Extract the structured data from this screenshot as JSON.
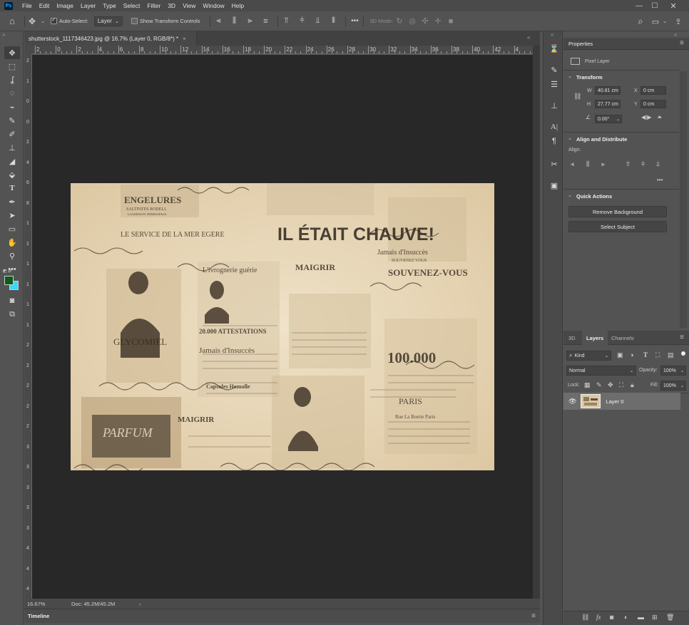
{
  "menubar": {
    "logo": "Ps",
    "items": [
      "File",
      "Edit",
      "Image",
      "Layer",
      "Type",
      "Select",
      "Filter",
      "3D",
      "View",
      "Window",
      "Help"
    ]
  },
  "options": {
    "auto_select_label": "Auto-Select:",
    "auto_select_value": "Layer",
    "show_transform_label": "Show Transform Controls",
    "more": "•••",
    "mode_3d_label": "3D Mode:"
  },
  "document": {
    "tab_title": "shutterstock_1117346423.jpg @ 16.7% (Layer 0, RGB/8*) *",
    "close": "×",
    "ruler_h": [
      "2",
      "0",
      "2",
      "4",
      "6",
      "8",
      "10",
      "12",
      "14",
      "16",
      "18",
      "20",
      "22",
      "24",
      "26",
      "28",
      "30",
      "32",
      "34",
      "36",
      "38",
      "40",
      "42",
      "4"
    ],
    "ruler_v": [
      "2",
      "1",
      "0",
      "0",
      "2",
      "4",
      "6",
      "8",
      "1",
      "1",
      "1",
      "1",
      "1",
      "1",
      "2",
      "2",
      "2",
      "2",
      "2",
      "3",
      "3",
      "3",
      "3",
      "3",
      "4",
      "4",
      "4"
    ]
  },
  "status": {
    "zoom": "16.67%",
    "doc": "Doc: 45.2M/45.2M",
    "arrow": "›"
  },
  "timeline": {
    "label": "Timeline"
  },
  "artwork": {
    "headline": "IL ÉTAIT CHAUVE!",
    "texts": [
      "ENGELURES",
      "SALTPATES RODELL",
      "GUERISON IMMEDIATE",
      "LE SERVICE DE LA MER EGERE",
      "GLYCOMIEL",
      "L'ivrognerie guérie",
      "20.000 ATTESTATIONS",
      "Jamais d'Insuccès",
      "MAIGRIR",
      "SOUVENEZ-VOUS",
      "100.000",
      "PARIS",
      "Rue La Boetie Paris",
      "PARFUM",
      "SOUVENEZ VOUS",
      "MAIGRIR",
      "Capsules Homolle",
      "Jamais d'Insuccès"
    ]
  },
  "properties": {
    "title": "Properties",
    "pixel_layer": "Pixel Layer",
    "transform_hdr": "Transform",
    "w_label": "W",
    "w_value": "40.81 cm",
    "x_label": "X",
    "x_value": "0 cm",
    "h_label": "H",
    "h_value": "27.77 cm",
    "y_label": "Y",
    "y_value": "0 cm",
    "angle_value": "0.00°",
    "align_hdr": "Align and Distribute",
    "align_label": "Align:",
    "more": "•••",
    "quick_actions_hdr": "Quick Actions",
    "remove_bg": "Remove Background",
    "select_subject": "Select Subject"
  },
  "layers": {
    "tabs": [
      "3D",
      "Layers",
      "Channels"
    ],
    "kind": "Kind",
    "blend_mode": "Normal",
    "opacity_label": "Opacity:",
    "opacity_value": "100%",
    "lock_label": "Lock:",
    "fill_label": "Fill:",
    "fill_value": "100%",
    "layer_name": "Layer 0"
  },
  "colors": {
    "foreground": "#0b5b1a",
    "background": "#3ad6ff",
    "accent": "#31a8ff"
  }
}
